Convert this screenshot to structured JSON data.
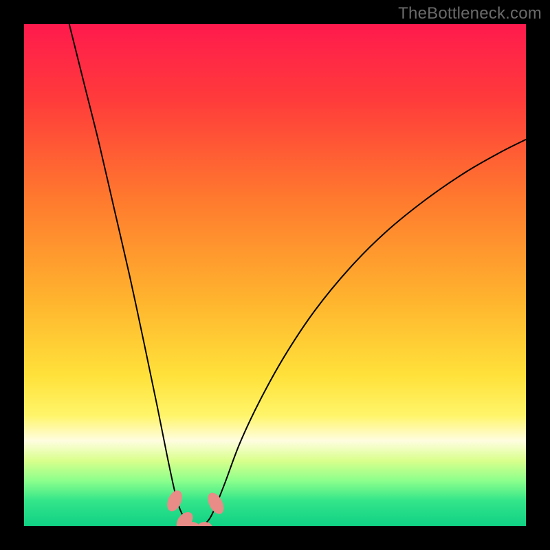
{
  "watermark": "TheBottleneck.com",
  "chart_data": {
    "type": "line",
    "title": "",
    "xlabel": "",
    "ylabel": "",
    "xlim": [
      0,
      100
    ],
    "ylim": [
      0,
      100
    ],
    "background_gradient": {
      "stops": [
        {
          "offset": 0.0,
          "color": "#ff1a4d"
        },
        {
          "offset": 0.15,
          "color": "#ff3b3b"
        },
        {
          "offset": 0.35,
          "color": "#ff7a2e"
        },
        {
          "offset": 0.55,
          "color": "#ffb42e"
        },
        {
          "offset": 0.7,
          "color": "#ffe13a"
        },
        {
          "offset": 0.78,
          "color": "#fff56a"
        },
        {
          "offset": 0.83,
          "color": "#fffde0"
        },
        {
          "offset": 0.87,
          "color": "#d9ff8c"
        },
        {
          "offset": 0.91,
          "color": "#8cff8c"
        },
        {
          "offset": 0.95,
          "color": "#33e58a"
        },
        {
          "offset": 1.0,
          "color": "#10d184"
        }
      ]
    },
    "series": [
      {
        "name": "bottleneck-curve",
        "stroke": "#000000",
        "stroke_width": 2,
        "points": [
          {
            "x": 9.0,
            "y": 100.0
          },
          {
            "x": 12.0,
            "y": 88.0
          },
          {
            "x": 15.0,
            "y": 76.0
          },
          {
            "x": 18.0,
            "y": 63.0
          },
          {
            "x": 21.0,
            "y": 50.0
          },
          {
            "x": 24.0,
            "y": 36.0
          },
          {
            "x": 26.5,
            "y": 24.0
          },
          {
            "x": 28.5,
            "y": 14.0
          },
          {
            "x": 30.0,
            "y": 7.0
          },
          {
            "x": 31.0,
            "y": 3.5
          },
          {
            "x": 32.0,
            "y": 1.5
          },
          {
            "x": 33.0,
            "y": 0.4
          },
          {
            "x": 34.0,
            "y": 0.0
          },
          {
            "x": 35.0,
            "y": 0.0
          },
          {
            "x": 36.0,
            "y": 0.4
          },
          {
            "x": 37.0,
            "y": 1.5
          },
          {
            "x": 38.0,
            "y": 3.5
          },
          {
            "x": 40.0,
            "y": 8.5
          },
          {
            "x": 43.0,
            "y": 16.5
          },
          {
            "x": 47.0,
            "y": 25.0
          },
          {
            "x": 52.0,
            "y": 34.0
          },
          {
            "x": 58.0,
            "y": 43.0
          },
          {
            "x": 65.0,
            "y": 51.5
          },
          {
            "x": 72.0,
            "y": 58.5
          },
          {
            "x": 80.0,
            "y": 65.0
          },
          {
            "x": 88.0,
            "y": 70.5
          },
          {
            "x": 95.0,
            "y": 74.5
          },
          {
            "x": 100.0,
            "y": 77.0
          }
        ]
      }
    ],
    "markers": [
      {
        "name": "marker-left-upper",
        "cx": 30.0,
        "cy": 5.0,
        "rx": 1.3,
        "ry": 2.2,
        "rotate": 24,
        "fill": "#e98b87"
      },
      {
        "name": "marker-left-lower",
        "cx": 32.0,
        "cy": 1.0,
        "rx": 1.3,
        "ry": 2.0,
        "rotate": 40,
        "fill": "#e98b87"
      },
      {
        "name": "marker-bottom-left",
        "cx": 33.5,
        "cy": -0.3,
        "rx": 1.5,
        "ry": 1.1,
        "rotate": 0,
        "fill": "#e98b87"
      },
      {
        "name": "marker-bottom-right",
        "cx": 36.0,
        "cy": -0.3,
        "rx": 1.5,
        "ry": 1.1,
        "rotate": 0,
        "fill": "#e98b87"
      },
      {
        "name": "marker-right",
        "cx": 38.2,
        "cy": 4.5,
        "rx": 1.3,
        "ry": 2.3,
        "rotate": -28,
        "fill": "#e98b87"
      }
    ]
  }
}
